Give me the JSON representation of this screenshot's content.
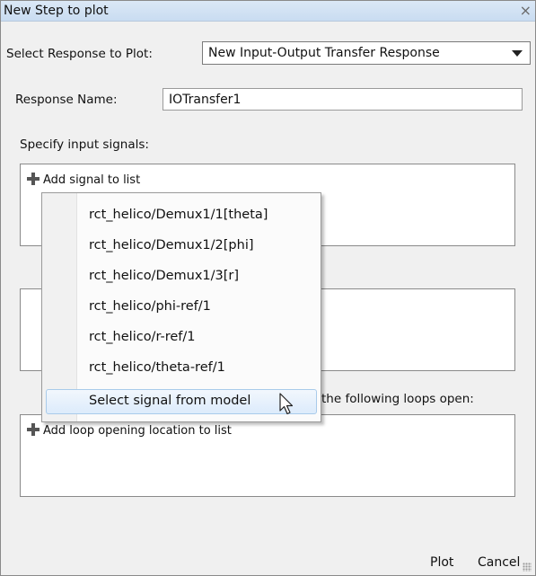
{
  "window": {
    "title": "New Step to plot",
    "close_glyph": "×"
  },
  "response_select": {
    "label": "Select Response to Plot:",
    "value": "New Input-Output Transfer Response"
  },
  "response_name": {
    "label": "Response Name:",
    "value": "IOTransfer1"
  },
  "input_signals": {
    "label": "Specify input signals:",
    "add_label": "Add signal to list"
  },
  "loops": {
    "label_partial": "the following loops open:",
    "add_label": "Add loop opening location to list"
  },
  "signal_menu": {
    "items": [
      "rct_helico/Demux1/1[theta]",
      "rct_helico/Demux1/2[phi]",
      "rct_helico/Demux1/3[r]",
      "rct_helico/phi-ref/1",
      "rct_helico/r-ref/1",
      "rct_helico/theta-ref/1",
      "Select signal from model"
    ]
  },
  "buttons": {
    "plot": "Plot",
    "cancel": "Cancel"
  },
  "icons": {
    "close": "close-icon",
    "dropdown": "chevron-down-icon",
    "add": "plus-icon",
    "cursor": "mouse-pointer-icon",
    "resize": "resize-grip-icon"
  }
}
